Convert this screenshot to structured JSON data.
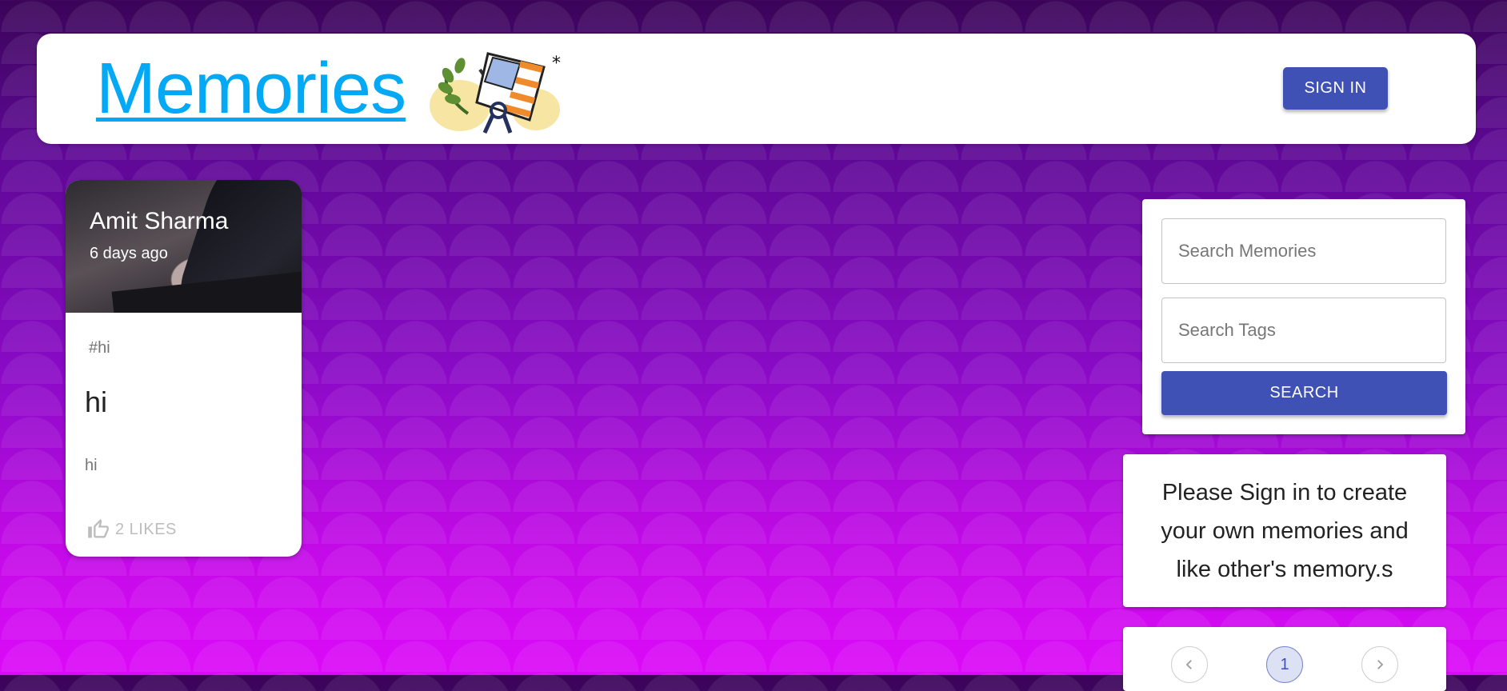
{
  "header": {
    "brand": "Memories",
    "logo_icon": "flag-laurel-logo-icon",
    "signin_label": "SIGN IN"
  },
  "posts": [
    {
      "author": "Amit Sharma",
      "time": "6 days ago",
      "tags": "#hi",
      "title": "hi",
      "message": "hi",
      "likes_label": "2 LIKES",
      "like_icon": "thumb-up-icon"
    }
  ],
  "search": {
    "memories_placeholder": "Search Memories",
    "tags_placeholder": "Search Tags",
    "button_label": "SEARCH"
  },
  "info": {
    "text": "Please Sign in to create your own memories and like other's memory.s"
  },
  "pagination": {
    "pages": [
      "1"
    ],
    "current": "1",
    "prev_icon": "chevron-left-icon",
    "next_icon": "chevron-right-icon"
  },
  "colors": {
    "primary": "#3f51b5",
    "brand": "#03a9f4"
  }
}
